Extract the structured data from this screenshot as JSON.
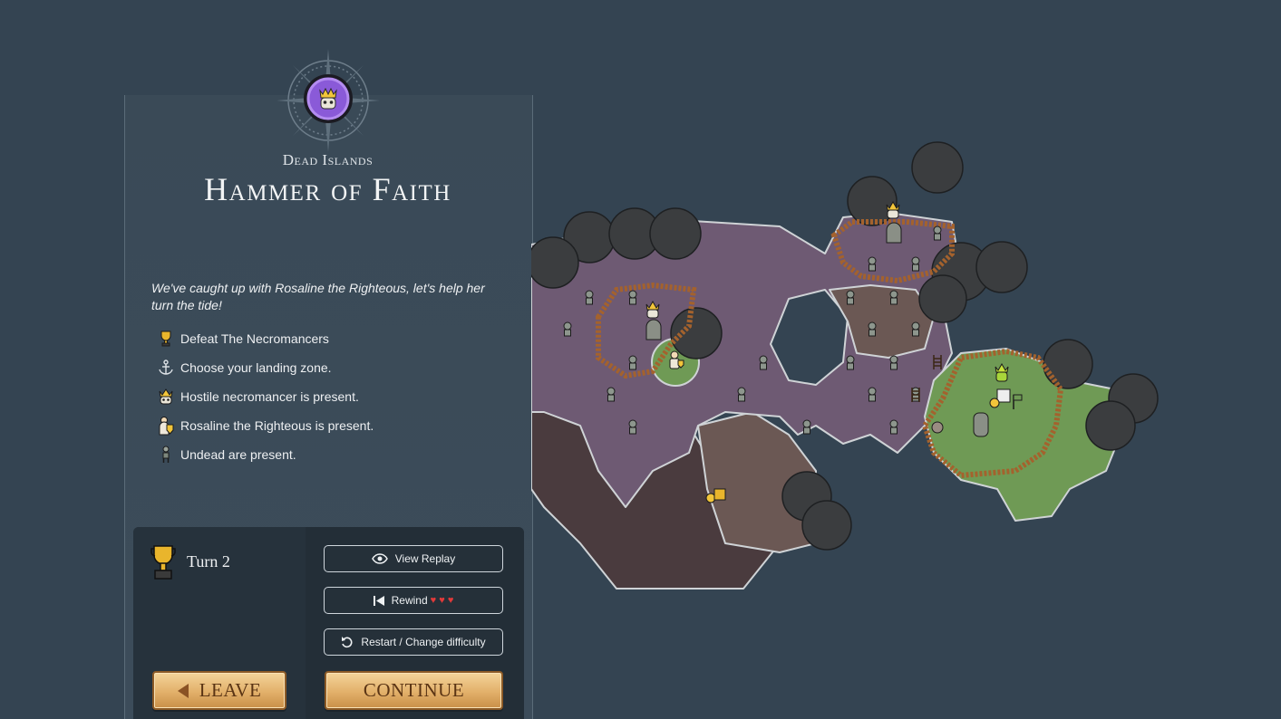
{
  "header": {
    "region": "Dead Islands",
    "title": "Hammer of Faith"
  },
  "briefing": {
    "intro": "We've caught up with Rosaline the Righteous, let's help her turn the tide!",
    "objectives": [
      {
        "icon": "trophy-icon",
        "text": "Defeat The Necromancers"
      },
      {
        "icon": "anchor-icon",
        "text": "Choose your landing zone."
      },
      {
        "icon": "necromancer-icon",
        "text": "Hostile necromancer is present."
      },
      {
        "icon": "rosaline-icon",
        "text": "Rosaline the Righteous is present."
      },
      {
        "icon": "undead-icon",
        "text": "Undead are present."
      }
    ]
  },
  "status": {
    "turn_label": "Turn 2"
  },
  "actions": {
    "view_replay": "View Replay",
    "rewind": "Rewind",
    "rewind_hearts": "♥ ♥ ♥",
    "restart": "Restart / Change difficulty",
    "leave": "LEAVE",
    "continue": "CONTINUE"
  },
  "colors": {
    "background": "#344452",
    "map_purple": "#6e5a73",
    "map_brown": "#6b5854",
    "map_dark": "#4a3b3e",
    "map_green": "#6f9a55",
    "button_gold": "#e2b06a",
    "heart": "#e23a3a"
  }
}
